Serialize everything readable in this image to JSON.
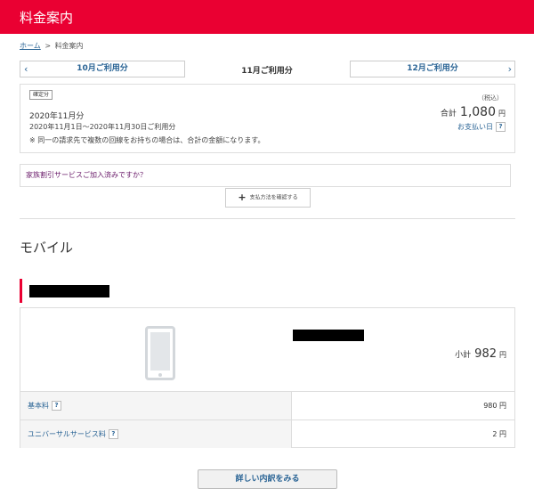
{
  "header": {
    "title": "料金案内"
  },
  "breadcrumb": {
    "home": "ホーム",
    "separator": ">",
    "current": "料金案内"
  },
  "month_nav": {
    "prev_label": "10月ご利用分",
    "current_label": "11月ご利用分",
    "next_label": "12月ご利用分",
    "prev_icon": "‹",
    "next_icon": "›"
  },
  "summary": {
    "badge": "確定分",
    "month": "2020年11月分",
    "period": "2020年11月1日～2020年11月30日ご利用分",
    "note": "※ 同一の請求先で複数の回線をお持ちの場合は、合計の金額になります。",
    "tax_note": "（税込）",
    "total_label": "合計",
    "total_amount": "1,080",
    "currency": "円",
    "payment_date_label": "お支払い日",
    "help_mark": "?"
  },
  "family_discount_link": "家族割引サービスご加入済みですか？",
  "payment_method_button": {
    "icon": "+",
    "label": "支払方法を確認する"
  },
  "section_title": "モバイル",
  "device": {
    "subtotal_label": "小計",
    "subtotal_amount": "982",
    "currency": "円",
    "fees": [
      {
        "label": "基本料",
        "help": "?",
        "value": "980 円"
      },
      {
        "label": "ユニバーサルサービス料",
        "help": "?",
        "value": "2 円"
      }
    ]
  },
  "detail_button": "詳しい内訳をみる",
  "colors": {
    "brand_red": "#ea0032",
    "link_blue": "#2a6495",
    "link_purple": "#6a1b6a"
  }
}
